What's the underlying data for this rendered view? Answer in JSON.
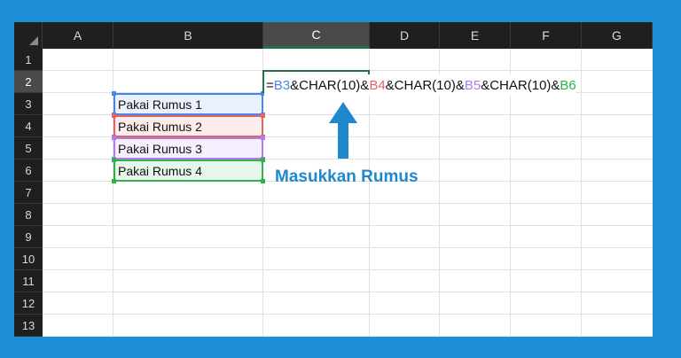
{
  "columns": [
    "A",
    "B",
    "C",
    "D",
    "E",
    "F",
    "G"
  ],
  "active_column": "C",
  "rows": [
    "1",
    "2",
    "3",
    "4",
    "5",
    "6",
    "7",
    "8",
    "9",
    "10",
    "11",
    "12",
    "13"
  ],
  "active_row": "2",
  "cells": {
    "B3": "Pakai Rumus 1",
    "B4": "Pakai Rumus 2",
    "B5": "Pakai Rumus 3",
    "B6": "Pakai Rumus 4"
  },
  "formula_parts": [
    {
      "text": "=",
      "color": "#111111"
    },
    {
      "text": "B3",
      "color": "#4a86e8"
    },
    {
      "text": "&CHAR(10)&",
      "color": "#111111"
    },
    {
      "text": "B4",
      "color": "#e06666"
    },
    {
      "text": "&CHAR(10)&",
      "color": "#111111"
    },
    {
      "text": "B5",
      "color": "#b07cf0"
    },
    {
      "text": "&CHAR(10)&",
      "color": "#111111"
    },
    {
      "text": "B6",
      "color": "#2eb34a"
    }
  ],
  "range_colors": {
    "B3": {
      "border": "#4a86e8",
      "fill": "#eaf0fc"
    },
    "B4": {
      "border": "#e06666",
      "fill": "#fcecec"
    },
    "B5": {
      "border": "#b07cf0",
      "fill": "#f6effd"
    },
    "B6": {
      "border": "#2eb34a",
      "fill": "#e7f5ea"
    }
  },
  "callout": {
    "text": "Masukkan Rumus",
    "color": "#1f88cc"
  },
  "theme": {
    "accent": "#217346",
    "frame": "#1e8fd6",
    "header_bg": "#1f1f1f"
  }
}
